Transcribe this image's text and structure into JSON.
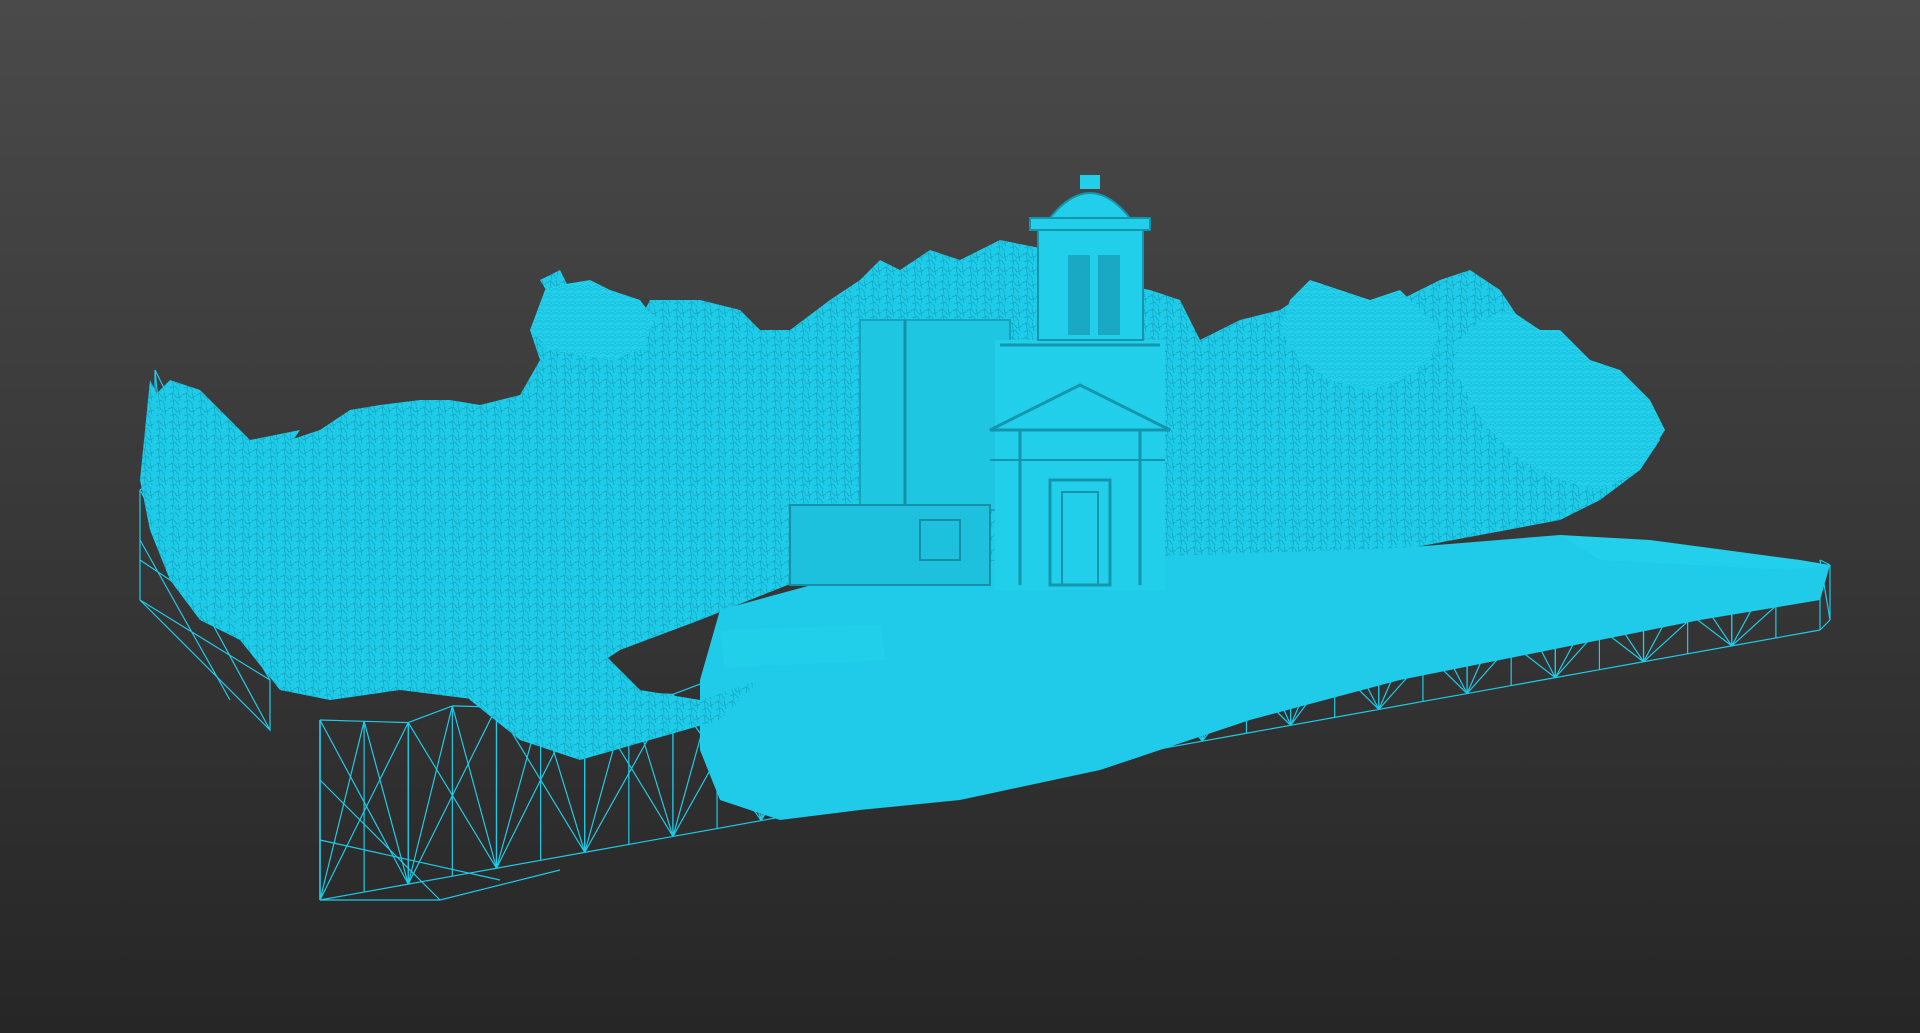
{
  "viewport": {
    "background_top": "#4a4a4a",
    "background_bottom": "#262626"
  },
  "model": {
    "render_mode": "wireframe",
    "mesh_color": "#1ecbe8",
    "subject": "church-with-bell-tower-and-trees-on-terrain-slab",
    "icon": "3d-mesh-icon"
  }
}
